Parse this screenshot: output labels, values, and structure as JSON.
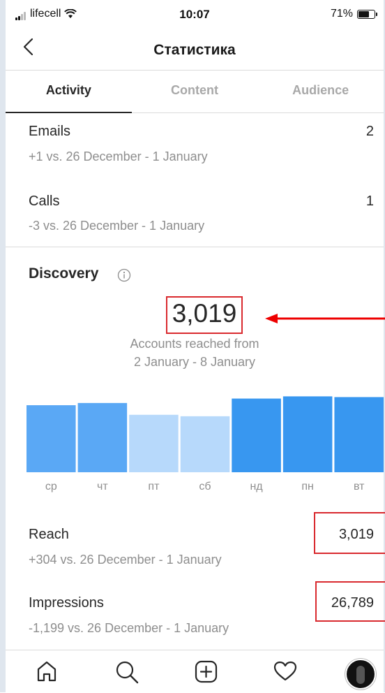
{
  "status_bar": {
    "carrier": "lifecell",
    "time": "10:07",
    "battery": "71%",
    "battery_level": 0.71
  },
  "header": {
    "title": "Статистика"
  },
  "tabs": [
    {
      "label": "Activity",
      "active": true
    },
    {
      "label": "Content",
      "active": false
    },
    {
      "label": "Audience",
      "active": false
    }
  ],
  "interactions": [
    {
      "label": "Emails",
      "value": "2",
      "change": "+1 vs. 26 December - 1 January"
    },
    {
      "label": "Calls",
      "value": "1",
      "change": "-3 vs. 26 December - 1 January"
    }
  ],
  "discovery": {
    "title": "Discovery",
    "accounts_reached": "3,019",
    "caption_line1": "Accounts reached from",
    "caption_line2": "2 January - 8 January"
  },
  "chart_data": {
    "type": "bar",
    "categories": [
      "ср",
      "чт",
      "пт",
      "сб",
      "нд",
      "пн",
      "вт"
    ],
    "values": [
      91,
      94,
      78,
      76,
      100,
      103,
      102
    ],
    "ylim": [
      0,
      110
    ],
    "colors": [
      "#5aa8f5",
      "#5aa8f5",
      "#b7d9fb",
      "#b7d9fb",
      "#3897f0",
      "#3897f0",
      "#3897f0"
    ],
    "title": "",
    "xlabel": "",
    "ylabel": ""
  },
  "metrics": [
    {
      "label": "Reach",
      "value": "3,019",
      "change": "+304 vs. 26 December - 1 January"
    },
    {
      "label": "Impressions",
      "value": "26,789",
      "change": "-1,199 vs. 26 December - 1 January"
    }
  ],
  "colors": {
    "highlight": "#d9292e",
    "bar_dark": "#3897f0",
    "bar_mid": "#5aa8f5",
    "bar_light": "#b7d9fb",
    "muted_text": "#8e8e8e"
  },
  "nav": [
    "home-icon",
    "search-icon",
    "new-post-icon",
    "heart-icon",
    "profile-avatar"
  ]
}
